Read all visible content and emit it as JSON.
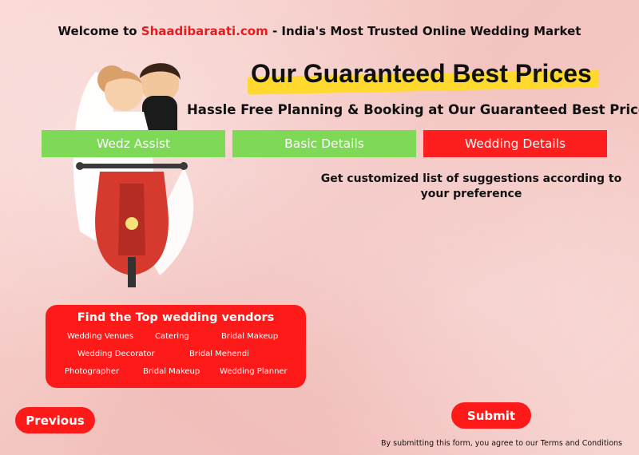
{
  "header": {
    "welcome_prefix": "Welcome to ",
    "brand": "Shaadibaraati.com",
    "welcome_suffix": " - India's Most Trusted Online Wedding Market"
  },
  "headline": "Our Guaranteed Best Prices",
  "subheadline": "Hassle Free Planning & Booking at Our Guaranteed Best Prices",
  "tabs": [
    {
      "label": "Wedz Assist",
      "color": "#7ed957",
      "active": false
    },
    {
      "label": "Basic Details",
      "color": "#7ed957",
      "active": false
    },
    {
      "label": "Wedding Details",
      "color": "#ff1e1e",
      "active": true
    }
  ],
  "description": "Get customized list of suggestions according to your preference",
  "vendors": {
    "title": "Find the Top wedding vendors",
    "links": [
      "Wedding Venues",
      "Catering",
      "Bridal Makeup",
      "Wedding Decorator",
      "Bridal Mehendi",
      "Photographer",
      "Bridal Makeup",
      "Wedding Planner"
    ]
  },
  "buttons": {
    "previous": "Previous",
    "submit": "Submit"
  },
  "terms": "By submitting this form, you agree to our Terms and Conditions",
  "colors": {
    "brand_red": "#ff1e1e",
    "green": "#7ed957",
    "highlight": "#ffd92e",
    "background": "#f6cdc9"
  },
  "illustration": "couple-on-scooter-icon"
}
